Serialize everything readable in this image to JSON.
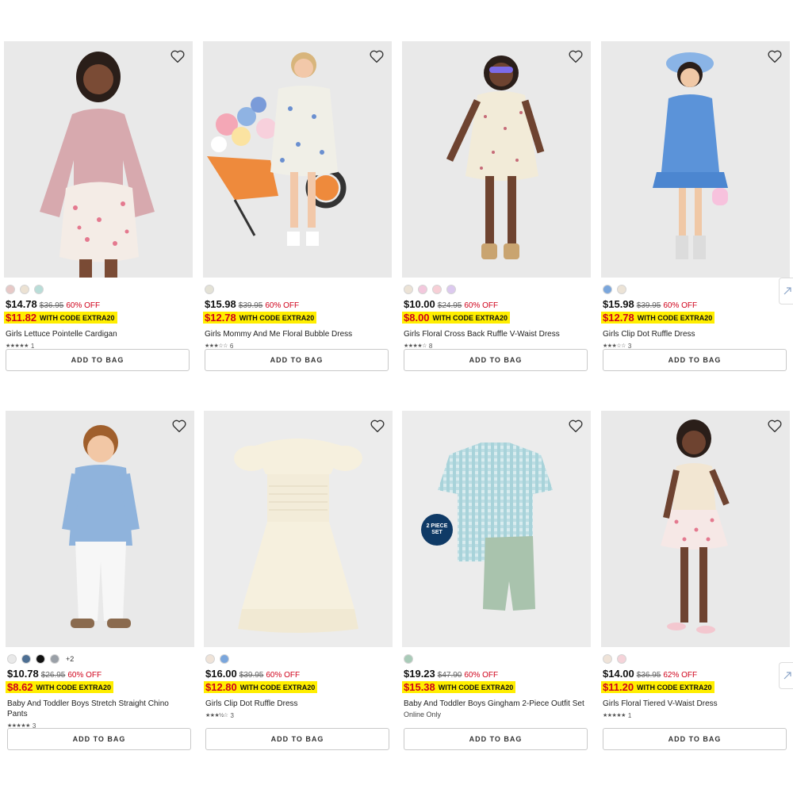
{
  "products": [
    {
      "swatches": [
        "#e7c9c7",
        "#ece2d3",
        "#b9ddd8"
      ],
      "more": "",
      "price": "$14.78",
      "orig": "$36.95",
      "off": "60% OFF",
      "promo_price": "$11.82",
      "promo_code": "WITH CODE EXTRA20",
      "title": "Girls Lettuce Pointelle Cardigan",
      "stars": "★★★★★",
      "reviews": "1",
      "online": ""
    },
    {
      "swatches": [
        "#e4e2d6"
      ],
      "more": "",
      "price": "$15.98",
      "orig": "$39.95",
      "off": "60% OFF",
      "promo_price": "$12.78",
      "promo_code": "WITH CODE EXTRA20",
      "title": "Girls Mommy And Me Floral Bubble Dress",
      "stars": "★★★☆☆",
      "reviews": "6",
      "online": ""
    },
    {
      "swatches": [
        "#ece3d6",
        "#f3c8dd",
        "#f7cfd6",
        "#dcc9ef"
      ],
      "more": "",
      "price": "$10.00",
      "orig": "$24.95",
      "off": "60% OFF",
      "promo_price": "$8.00",
      "promo_code": "WITH CODE EXTRA20",
      "title": "Girls Floral Cross Back Ruffle V-Waist Dress",
      "stars": "★★★★☆",
      "reviews": "8",
      "online": ""
    },
    {
      "swatches": [
        "#7aa6dc",
        "#ece3d6"
      ],
      "more": "",
      "price": "$15.98",
      "orig": "$39.95",
      "off": "60% OFF",
      "promo_price": "$12.78",
      "promo_code": "WITH CODE EXTRA20",
      "title": "Girls Clip Dot Ruffle Dress",
      "stars": "★★★☆☆",
      "reviews": "3",
      "online": ""
    },
    {
      "swatches": [
        "#e9e9e9",
        "#4d6f93",
        "#111111",
        "#9aa0a7"
      ],
      "more": "+2",
      "price": "$10.78",
      "orig": "$26.95",
      "off": "60% OFF",
      "promo_price": "$8.62",
      "promo_code": "WITH CODE EXTRA20",
      "title": "Baby And Toddler Boys Stretch Straight Chino Pants",
      "stars": "★★★★★",
      "reviews": "3",
      "online": ""
    },
    {
      "swatches": [
        "#efe3d8",
        "#7aa6dc"
      ],
      "more": "",
      "price": "$16.00",
      "orig": "$39.95",
      "off": "60% OFF",
      "promo_price": "$12.80",
      "promo_code": "WITH CODE EXTRA20",
      "title": "Girls Clip Dot Ruffle Dress",
      "stars": "★★★½☆",
      "reviews": "3",
      "online": ""
    },
    {
      "swatches": [
        "#a9cbb8"
      ],
      "more": "",
      "price": "$19.23",
      "orig": "$47.90",
      "off": "60% OFF",
      "promo_price": "$15.38",
      "promo_code": "WITH CODE EXTRA20",
      "title": "Baby And Toddler Boys Gingham 2-Piece Outfit Set",
      "stars": "",
      "reviews": "",
      "online": "Online Only",
      "badge": "2 PIECE SET"
    },
    {
      "swatches": [
        "#efe3d8",
        "#f5d3d9"
      ],
      "more": "",
      "price": "$14.00",
      "orig": "$36.95",
      "off": "62% OFF",
      "promo_price": "$11.20",
      "promo_code": "WITH CODE EXTRA20",
      "title": "Girls Floral Tiered V-Waist Dress",
      "stars": "★★★★★",
      "reviews": "1",
      "online": ""
    }
  ],
  "add_to_bag_label": "ADD TO BAG",
  "colors": {
    "sale_red": "#d0021b",
    "promo_yellow": "#ffee00",
    "image_bg": "#ececec"
  },
  "icons": {
    "wishlist": "heart-icon",
    "side_button": "arrow-icon"
  }
}
